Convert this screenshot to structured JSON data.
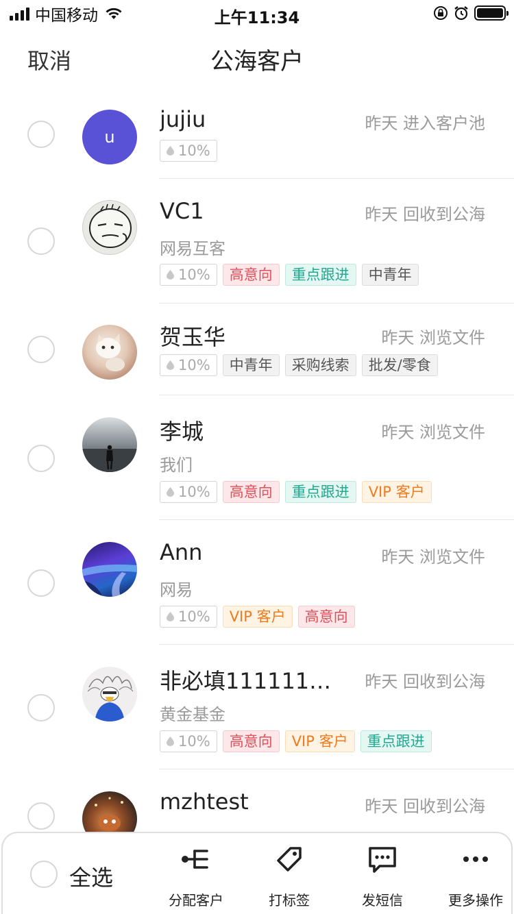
{
  "status_bar": {
    "carrier": "中国移动",
    "time": "上午11:34"
  },
  "nav": {
    "cancel": "取消",
    "title": "公海客户"
  },
  "customers": [
    {
      "name": "jujiu",
      "activity": "昨天 进入客户池",
      "company": "",
      "probability": "10%",
      "avatar_letter": "u",
      "tags": []
    },
    {
      "name": "VC1",
      "activity": "昨天 回收到公海",
      "company": "网易互客",
      "probability": "10%",
      "avatar_letter": "",
      "tags": [
        "高意向",
        "重点跟进",
        "中青年"
      ]
    },
    {
      "name": "贺玉华",
      "activity": "昨天 浏览文件",
      "company": "",
      "probability": "10%",
      "avatar_letter": "",
      "tags": [
        "中青年",
        "采购线索",
        "批发/零食"
      ]
    },
    {
      "name": "李城",
      "activity": "昨天 浏览文件",
      "company": "我们",
      "probability": "10%",
      "avatar_letter": "",
      "tags": [
        "高意向",
        "重点跟进",
        "VIP 客户"
      ]
    },
    {
      "name": "Ann",
      "activity": "昨天 浏览文件",
      "company": "网易",
      "probability": "10%",
      "avatar_letter": "",
      "tags": [
        "VIP 客户",
        "高意向"
      ]
    },
    {
      "name": "非必填1111111111...",
      "activity": "昨天 回收到公海",
      "company": "黄金基金",
      "probability": "10%",
      "avatar_letter": "",
      "tags": [
        "高意向",
        "VIP 客户",
        "重点跟进"
      ]
    },
    {
      "name": "mzhtest",
      "activity": "昨天 回收到公海",
      "company": "",
      "probability": "",
      "avatar_letter": "",
      "tags": []
    }
  ],
  "toolbar": {
    "select_all": "全选",
    "assign": "分配客户",
    "tag": "打标签",
    "sms": "发短信",
    "more": "更多操作"
  },
  "colors": {
    "avatar_letter_bg": "#5a52d6",
    "tag_red": "#e0505a",
    "tag_green": "#21a88f",
    "tag_orange": "#f07a1e"
  }
}
